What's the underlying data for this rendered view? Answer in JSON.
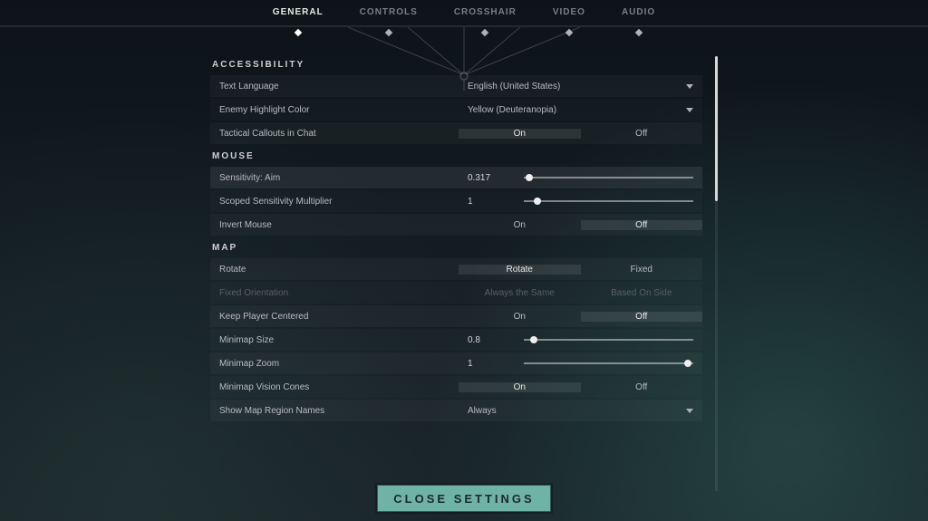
{
  "tabs": {
    "general": "GENERAL",
    "controls": "CONTROLS",
    "crosshair": "CROSSHAIR",
    "video": "VIDEO",
    "audio": "AUDIO"
  },
  "sections": {
    "accessibility": "ACCESSIBILITY",
    "mouse": "MOUSE",
    "map": "MAP"
  },
  "accessibility": {
    "text_language": {
      "label": "Text Language",
      "value": "English (United States)"
    },
    "enemy_highlight": {
      "label": "Enemy Highlight Color",
      "value": "Yellow (Deuteranopia)"
    },
    "tactical_callouts": {
      "label": "Tactical Callouts in Chat",
      "on": "On",
      "off": "Off"
    }
  },
  "mouse": {
    "sensitivity": {
      "label": "Sensitivity: Aim",
      "value": "0.317"
    },
    "scoped": {
      "label": "Scoped Sensitivity Multiplier",
      "value": "1"
    },
    "invert": {
      "label": "Invert Mouse",
      "on": "On",
      "off": "Off"
    }
  },
  "map": {
    "rotate": {
      "label": "Rotate",
      "opt_rotate": "Rotate",
      "opt_fixed": "Fixed"
    },
    "fixed_orientation": {
      "label": "Fixed Orientation",
      "opt_same": "Always the Same",
      "opt_side": "Based On Side"
    },
    "keep_centered": {
      "label": "Keep Player Centered",
      "on": "On",
      "off": "Off"
    },
    "minimap_size": {
      "label": "Minimap Size",
      "value": "0.8"
    },
    "minimap_zoom": {
      "label": "Minimap Zoom",
      "value": "1"
    },
    "vision_cones": {
      "label": "Minimap Vision Cones",
      "on": "On",
      "off": "Off"
    },
    "region_names": {
      "label": "Show Map Region Names",
      "value": "Always"
    }
  },
  "close_button": "CLOSE SETTINGS"
}
